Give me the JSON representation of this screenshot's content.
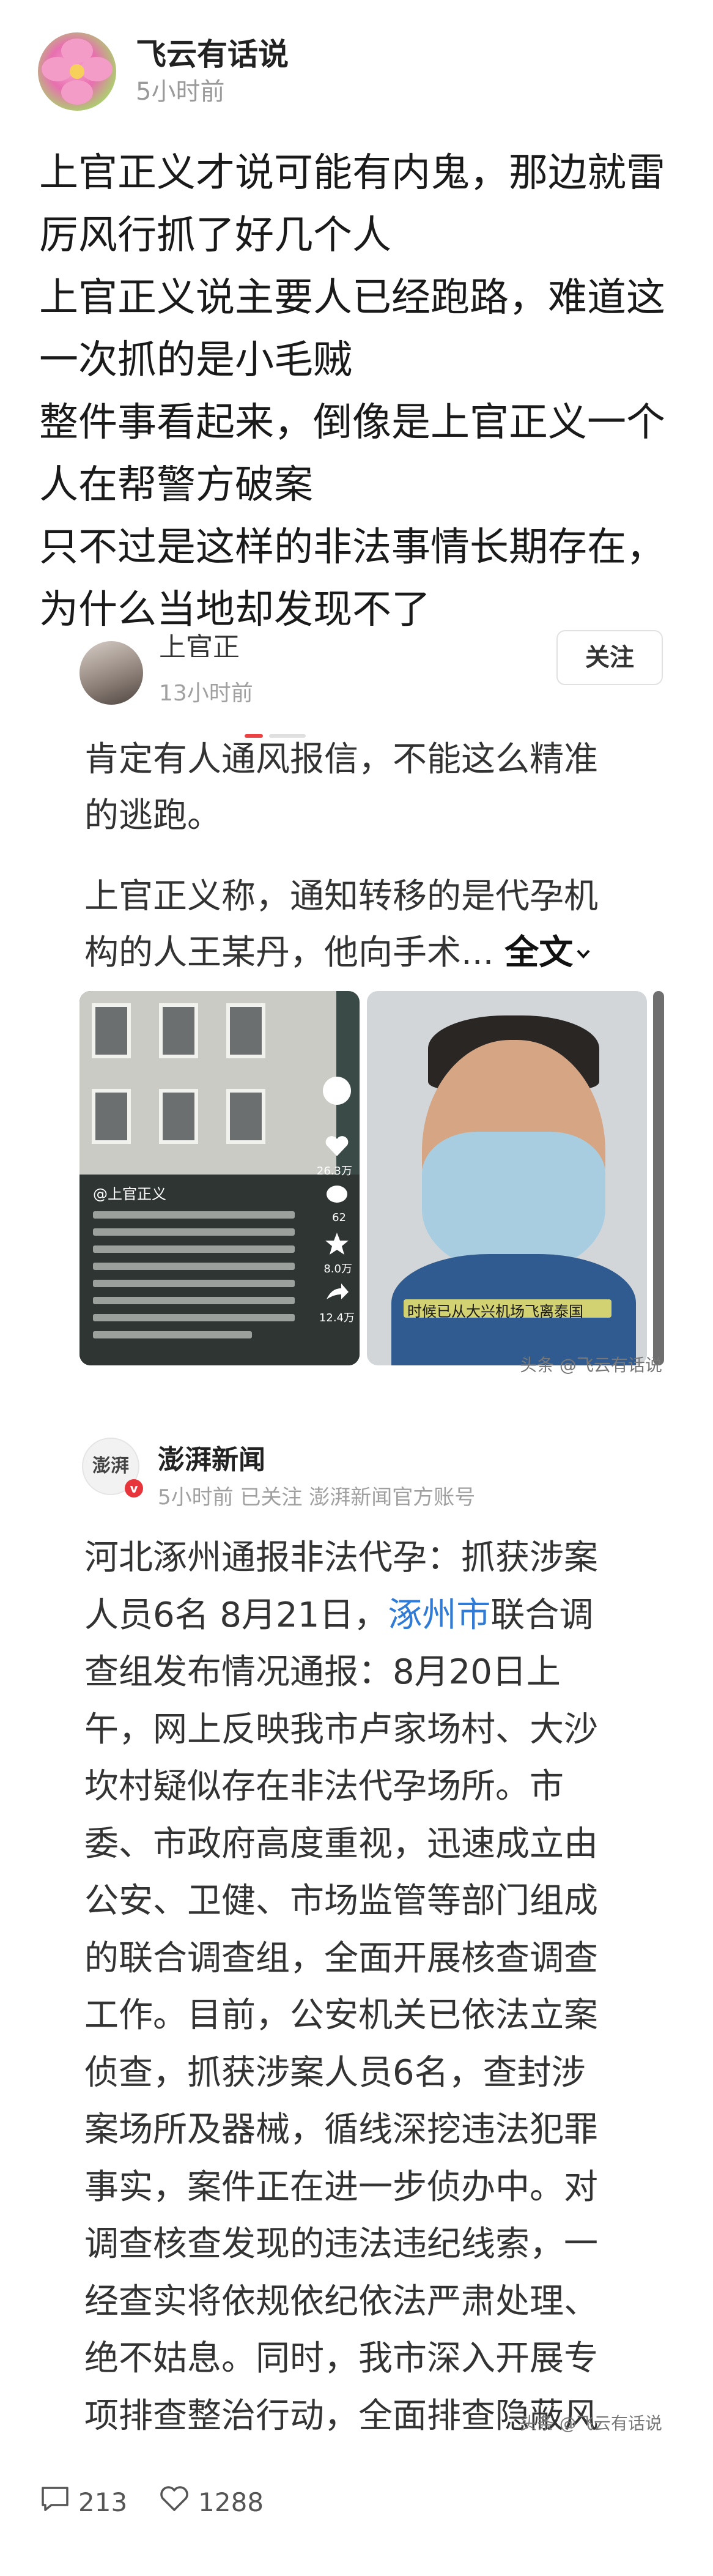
{
  "post": {
    "author": "飞云有话说",
    "time": "5小时前",
    "lines": [
      "上官正义才说可能有内鬼，那边就雷",
      "厉风行抓了好几个人",
      "上官正义说主要人已经跑路，难道这",
      "一次抓的是小毛贼",
      "整件事看起来，倒像是上官正义一个",
      "人在帮警方破案",
      "只不过是这样的非法事情长期存在，",
      "为什么当地却发现不了"
    ]
  },
  "quote1": {
    "author_partial": "上官正",
    "time": "13小时前",
    "follow_label": "关注",
    "lines": [
      "肯定有人通风报信，不能这么精准",
      "的逃跑。",
      "",
      "上官正义称，通知转移的是代孕机",
      "构的人王某丹，他向手术..."
    ],
    "read_more": "全文",
    "thumb1_caption": "@上官正义",
    "thumb1_counts": [
      "26.3万",
      "62",
      "8.0万",
      "12.4万"
    ],
    "thumb2_caption": "时候已从大兴机场飞离泰国",
    "watermark": "头条 @飞云有话说"
  },
  "quote2": {
    "source_logo": "澎湃",
    "source_name": "澎湃新闻",
    "meta": "5小时前  已关注  澎湃新闻官方账号",
    "lines": [
      [
        "河北涿州通报非法代孕：抓获涉案"
      ],
      [
        "人员6名 8月21日，",
        "涿州市",
        "联合调"
      ],
      [
        "查组发布情况通报：8月20日上"
      ],
      [
        "午，网上反映我市卢家场村、大沙"
      ],
      [
        "坎村疑似存在非法代孕场所。市"
      ],
      [
        "委、市政府高度重视，迅速成立由"
      ],
      [
        "公安、卫健、市场监管等部门组成"
      ],
      [
        "的联合调查组，全面开展核查调查"
      ],
      [
        "工作。目前，公安机关已依法立案"
      ],
      [
        "侦查，抓获涉案人员6名，查封涉"
      ],
      [
        "案场所及器械，循线深挖违法犯罪"
      ],
      [
        "事实，案件正在进一步侦办中。对"
      ],
      [
        "调查核查发现的违法违纪线索，一"
      ],
      [
        "经查实将依规依纪依法严肃处理、"
      ],
      [
        "绝不姑息。同时，我市深入开展专"
      ],
      [
        "项排查整治行动，全面排查隐蔽风"
      ]
    ],
    "watermark": "头条 @飞云有话说"
  },
  "footer": {
    "comments": "213",
    "likes": "1288"
  },
  "colors": {
    "link": "#2f7bd6",
    "meta_gray": "#9a9a9a"
  }
}
